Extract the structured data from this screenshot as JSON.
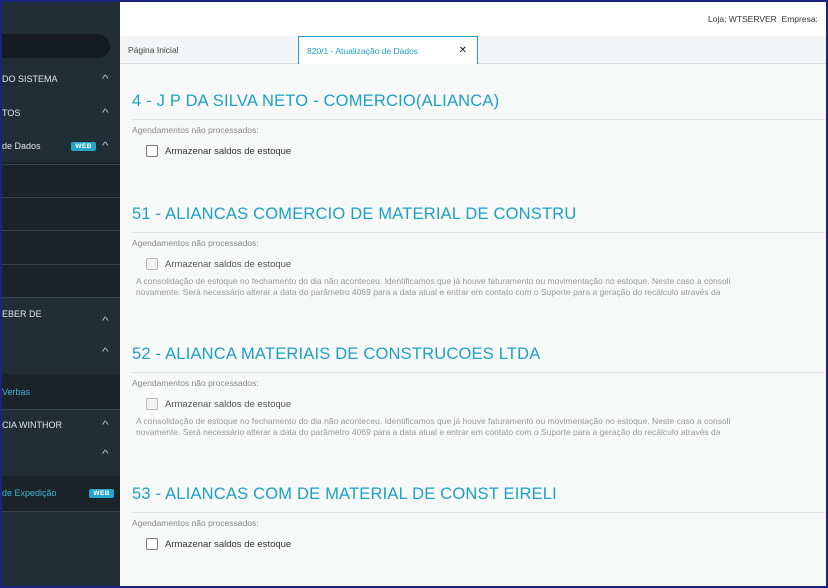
{
  "header": {
    "store_label": "Loja: WTSERVER",
    "company_label": "Empresa:"
  },
  "tabs": [
    {
      "label": "Página Inicial"
    },
    {
      "label": "820/1 - Atualização de Dados",
      "close_icon": "close-icon"
    }
  ],
  "sidebar": {
    "items": [
      {
        "label": "DO SISTEMA"
      },
      {
        "label": "TOS"
      },
      {
        "label": "de Dados",
        "badge": "WEB"
      },
      {
        "label": "EBER DE"
      },
      {
        "label": "Verbas"
      },
      {
        "label": "CIA WINTHOR"
      },
      {
        "label": "de Expedição",
        "badge": "WEB"
      }
    ]
  },
  "sections": [
    {
      "title": "4 - J P DA SILVA NETO - COMERCIO(ALIANCA)",
      "subtitle": "Agendamentos não processados:",
      "checkbox_label": "Armazenar saldos de estoque",
      "disabled": false
    },
    {
      "title": "51 - ALIANCAS COMERCIO DE MATERIAL DE CONSTRU",
      "subtitle": "Agendamentos não processados:",
      "checkbox_label": "Armazenar saldos de estoque",
      "disabled": true,
      "note_line1": "A consolidação de estoque no fechamento do dia não aconteceu. Identificamos que já houve faturamento ou movimentação no estoque. Neste caso a consoli",
      "note_line2": "novamente. Será necessário alterar a data do parâmetro 4069 para a data atual e entrar em contato com o Suporte para a geração do recálculo através da"
    },
    {
      "title": "52 - ALIANCA MATERIAIS DE CONSTRUCOES LTDA",
      "subtitle": "Agendamentos não processados:",
      "checkbox_label": "Armazenar saldos de estoque",
      "disabled": true,
      "note_line1": "A consolidação de estoque no fechamento do dia não aconteceu. Identificamos que já houve faturamento ou movimentação no estoque. Neste caso a consoli",
      "note_line2": "novamente. Será necessário alterar a data do parâmetro 4069 para a data atual e entrar em contato com o Suporte para a geração do recálculo através da"
    },
    {
      "title": "53 - ALIANCAS COM DE MATERIAL DE CONST EIRELI",
      "subtitle": "Agendamentos não processados:",
      "checkbox_label": "Armazenar saldos de estoque",
      "disabled": false
    }
  ],
  "colors": {
    "accent": "#1ea0c6",
    "sidebar_bg": "#222e35",
    "badge": "#26a5c8"
  }
}
